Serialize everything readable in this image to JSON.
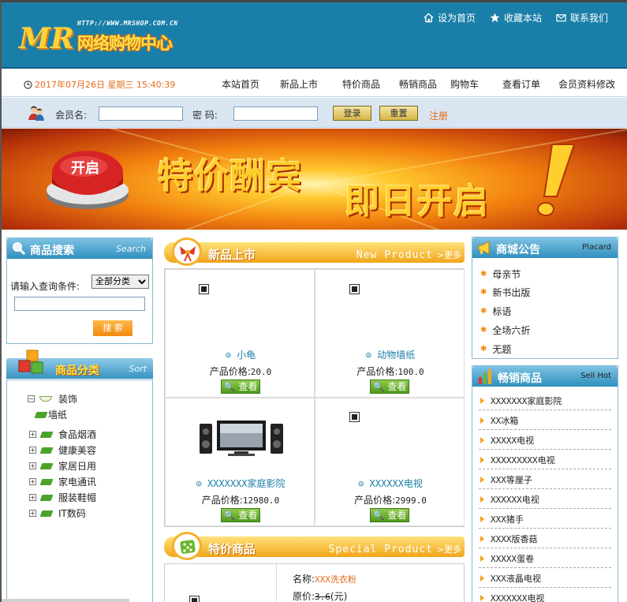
{
  "header": {
    "logo_mr": "MR",
    "logo_url": "HTTP://WWW.MRSHOP.COM.CN",
    "logo_name": "网络购物中心",
    "links": [
      "设为首页",
      "收藏本站",
      "联系我们"
    ]
  },
  "nav": {
    "datetime": "2017年07月26日 星期三 15:40:39",
    "items": [
      "本站首页",
      "新品上市",
      "特价商品",
      "畅销商品",
      "购物车",
      "查看订单",
      "会员资料修改"
    ]
  },
  "login": {
    "member_label": "会员名:",
    "password_label": "密 码:",
    "login_button": "登录",
    "reset_button": "重置",
    "register_link": "注册"
  },
  "banner": {
    "button_text": "开启",
    "text1": "特价酬宾",
    "text2": "即日开启"
  },
  "search": {
    "title": "商品搜索",
    "title_en": "Search",
    "label": "请输入查询条件:",
    "category_selected": "全部分类",
    "button": "搜 索"
  },
  "categories": {
    "title": "商品分类",
    "title_en": "Sort",
    "expanded": "装饰",
    "expanded_child": "墙纸",
    "items": [
      "食品烟酒",
      "健康美容",
      "家居日用",
      "家电通讯",
      "服装鞋帽",
      "IT数码"
    ]
  },
  "new_products": {
    "title": "新品上市",
    "title_en": "New Product",
    "more": "更多",
    "price_label": "产品价格:",
    "view_label": "查看",
    "items": [
      {
        "name": "小龟",
        "price": "20.0"
      },
      {
        "name": "动物墙纸",
        "price": "100.0"
      },
      {
        "name": "XXXXXXX家庭影院",
        "price": "12980.0"
      },
      {
        "name": "XXXXXX电视",
        "price": "2999.0"
      }
    ]
  },
  "special": {
    "title": "特价商品",
    "title_en": "Special Product",
    "more": "更多",
    "name_label": "名称:",
    "name": "XXX洗衣粉",
    "orig_label": "原价:",
    "orig_price": "3.6",
    "orig_unit": "(元)"
  },
  "notice": {
    "title": "商城公告",
    "title_en": "Placard",
    "items": [
      "母亲节",
      "新书出版",
      "标语",
      "全场六折",
      "无题"
    ]
  },
  "hot": {
    "title": "畅销商品",
    "title_en": "Sell Hot",
    "items": [
      "XXXXXXX家庭影院",
      "XX冰箱",
      "XXXXX电视",
      "XXXXXXXXX电视",
      "XXX等厘子",
      "XXXXXX电视",
      "XXX猪手",
      "XXXX版香菇",
      "XXXXX蛋卷",
      "XXX液晶电视",
      "XXXXXXX电视"
    ]
  },
  "colors": {
    "header_blue": "#1a7fa8",
    "accent_orange": "#e46b1a",
    "link_teal": "#1a7fa8"
  }
}
